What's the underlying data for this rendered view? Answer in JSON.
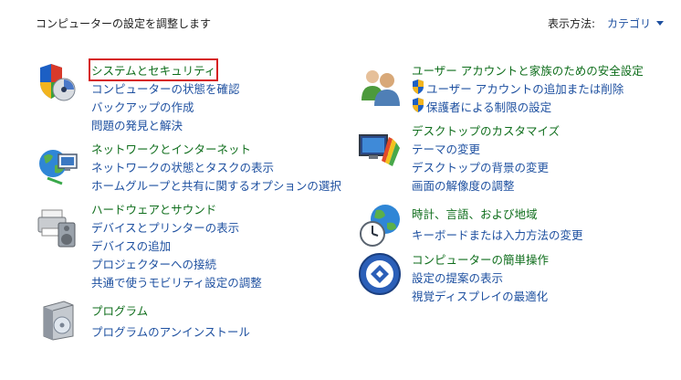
{
  "header": {
    "title": "コンピューターの設定を調整します",
    "view_label": "表示方法:",
    "view_value": "カテゴリ"
  },
  "left": [
    {
      "title": "システムとセキュリティ",
      "icon": "shield-security-icon",
      "links": [
        "コンピューターの状態を確認",
        "バックアップの作成",
        "問題の発見と解決"
      ]
    },
    {
      "title": "ネットワークとインターネット",
      "icon": "network-globe-icon",
      "links": [
        "ネットワークの状態とタスクの表示",
        "ホームグループと共有に関するオプションの選択"
      ]
    },
    {
      "title": "ハードウェアとサウンド",
      "icon": "printer-speaker-icon",
      "links": [
        "デバイスとプリンターの表示",
        "デバイスの追加",
        "プロジェクターへの接続",
        "共通で使うモビリティ設定の調整"
      ]
    },
    {
      "title": "プログラム",
      "icon": "programs-box-icon",
      "links": [
        "プログラムのアンインストール"
      ]
    }
  ],
  "right": [
    {
      "title": "ユーザー アカウントと家族のための安全設定",
      "icon": "users-icon",
      "links": [
        "ユーザー アカウントの追加または削除",
        "保護者による制限の設定"
      ]
    },
    {
      "title": "デスクトップのカスタマイズ",
      "icon": "monitor-paint-icon",
      "links": [
        "テーマの変更",
        "デスクトップの背景の変更",
        "画面の解像度の調整"
      ]
    },
    {
      "title": "時計、言語、および地域",
      "icon": "clock-globe-icon",
      "links": [
        "キーボードまたは入力方法の変更"
      ]
    },
    {
      "title": "コンピューターの簡単操作",
      "icon": "ease-of-access-icon",
      "links": [
        "設定の提案の表示",
        "視覚ディスプレイの最適化"
      ]
    }
  ]
}
